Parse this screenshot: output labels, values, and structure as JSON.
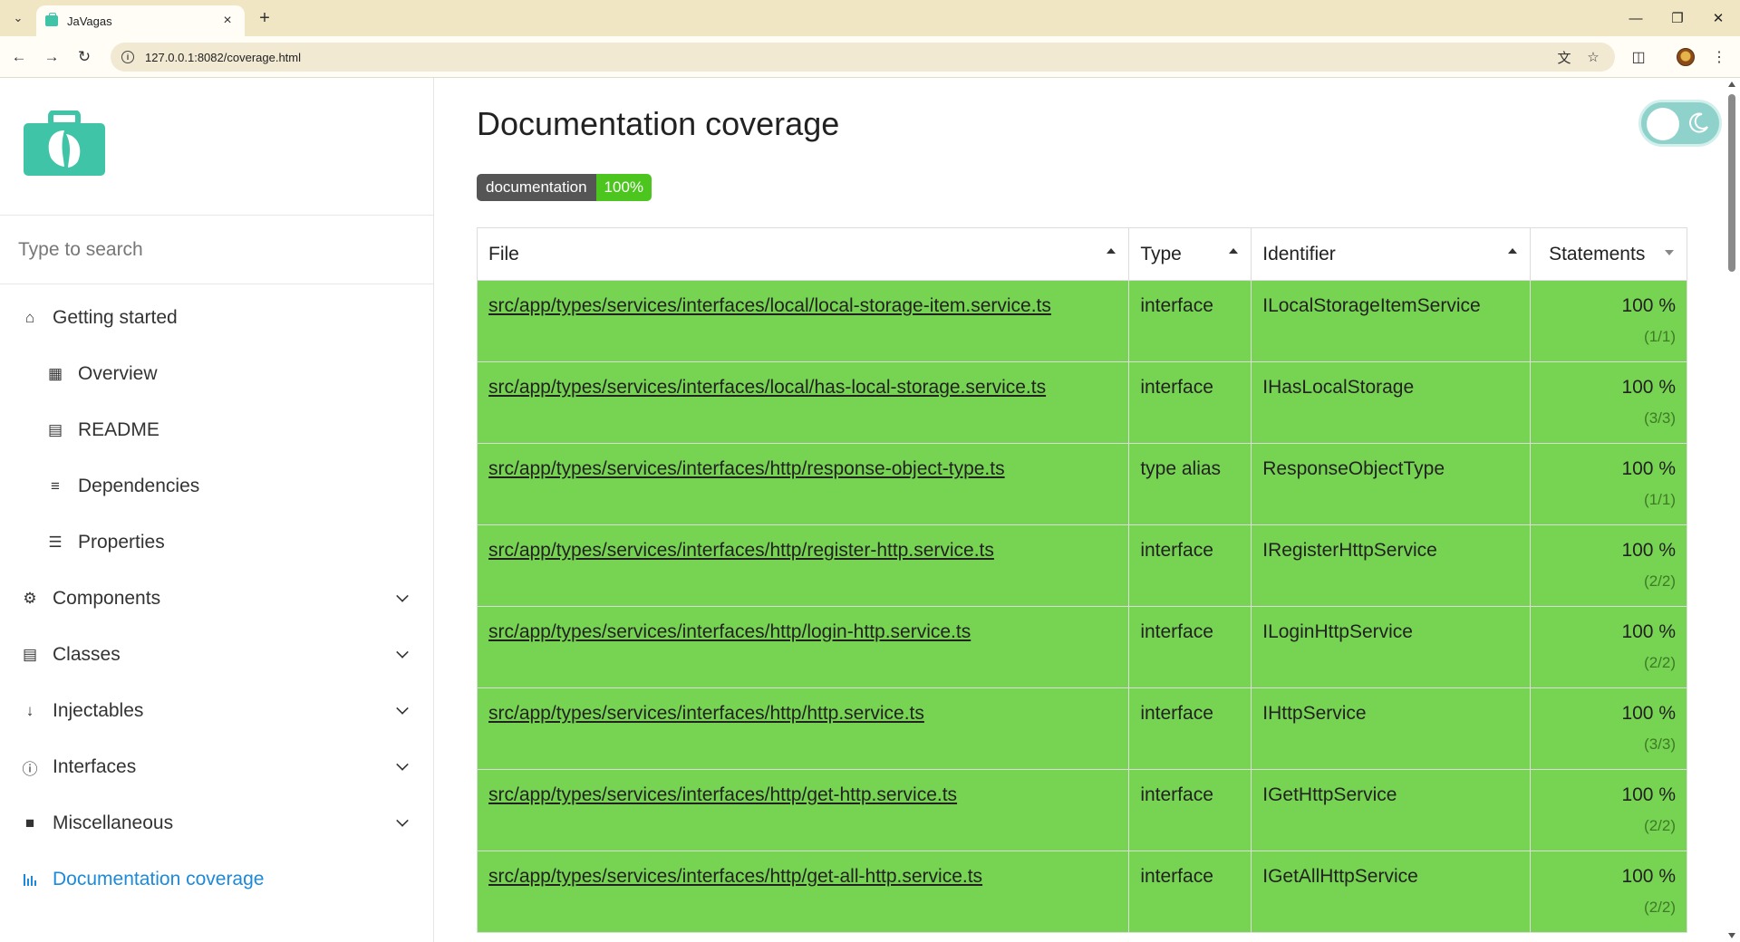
{
  "browser": {
    "tab_title": "JaVagas",
    "url": "127.0.0.1:8082/coverage.html",
    "icons": {
      "tabs_menu": "chevron-down-icon",
      "tab_close": "close-icon",
      "new_tab": "plus-icon",
      "back": "back-arrow-icon",
      "forward": "forward-arrow-icon",
      "reload": "reload-icon",
      "site_info": "info-icon",
      "translate": "translate-icon",
      "bookmark": "star-icon",
      "extensions": "puzzle-icon",
      "profile": "avatar",
      "menu": "kebab-menu-icon",
      "minimize": "minimize-icon",
      "restore": "restore-icon",
      "close_window": "close-icon"
    }
  },
  "sidebar": {
    "logo": "briefcase-leaf-logo",
    "search_placeholder": "Type to search",
    "menu": [
      {
        "label": "Getting started",
        "icon": "home-icon",
        "level": "top",
        "expandable": false
      },
      {
        "label": "Overview",
        "icon": "grid-icon",
        "level": "sub",
        "expandable": false
      },
      {
        "label": "README",
        "icon": "book-icon",
        "level": "sub",
        "expandable": false
      },
      {
        "label": "Dependencies",
        "icon": "list-icon",
        "level": "sub",
        "expandable": false
      },
      {
        "label": "Properties",
        "icon": "layers-icon",
        "level": "sub",
        "expandable": false
      },
      {
        "label": "Components",
        "icon": "cog-icon",
        "level": "top",
        "expandable": true
      },
      {
        "label": "Classes",
        "icon": "file-icon",
        "level": "top",
        "expandable": true
      },
      {
        "label": "Injectables",
        "icon": "arrow-down-icon",
        "level": "top",
        "expandable": true
      },
      {
        "label": "Interfaces",
        "icon": "info-icon",
        "level": "top",
        "expandable": true
      },
      {
        "label": "Miscellaneous",
        "icon": "cube-icon",
        "level": "top",
        "expandable": true
      },
      {
        "label": "Documentation coverage",
        "icon": "bar-chart-icon",
        "level": "top",
        "expandable": false,
        "active": true
      }
    ]
  },
  "main": {
    "title": "Documentation coverage",
    "theme_toggle_icon": "moon-icon",
    "badge": {
      "label": "documentation",
      "value": "100%"
    },
    "table": {
      "columns": [
        "File",
        "Type",
        "Identifier",
        "Statements"
      ],
      "rows": [
        {
          "file": "src/app/types/services/interfaces/local/local-storage-item.service.ts",
          "type": "interface",
          "identifier": "ILocalStorageItemService",
          "statements": "100 %",
          "ratio": "(1/1)"
        },
        {
          "file": "src/app/types/services/interfaces/local/has-local-storage.service.ts",
          "type": "interface",
          "identifier": "IHasLocalStorage",
          "statements": "100 %",
          "ratio": "(3/3)"
        },
        {
          "file": "src/app/types/services/interfaces/http/response-object-type.ts",
          "type": "type alias",
          "identifier": "ResponseObjectType",
          "statements": "100 %",
          "ratio": "(1/1)"
        },
        {
          "file": "src/app/types/services/interfaces/http/register-http.service.ts",
          "type": "interface",
          "identifier": "IRegisterHttpService",
          "statements": "100 %",
          "ratio": "(2/2)"
        },
        {
          "file": "src/app/types/services/interfaces/http/login-http.service.ts",
          "type": "interface",
          "identifier": "ILoginHttpService",
          "statements": "100 %",
          "ratio": "(2/2)"
        },
        {
          "file": "src/app/types/services/interfaces/http/http.service.ts",
          "type": "interface",
          "identifier": "IHttpService",
          "statements": "100 %",
          "ratio": "(3/3)"
        },
        {
          "file": "src/app/types/services/interfaces/http/get-http.service.ts",
          "type": "interface",
          "identifier": "IGetHttpService",
          "statements": "100 %",
          "ratio": "(2/2)"
        },
        {
          "file": "src/app/types/services/interfaces/http/get-all-http.service.ts",
          "type": "interface",
          "identifier": "IGetAllHttpService",
          "statements": "100 %",
          "ratio": "(2/2)"
        }
      ]
    }
  },
  "colors": {
    "row_green": "#77d452",
    "badge_green": "#4cc61e",
    "active_link": "#1d8ad9",
    "logo_teal": "#3fc4a8"
  }
}
